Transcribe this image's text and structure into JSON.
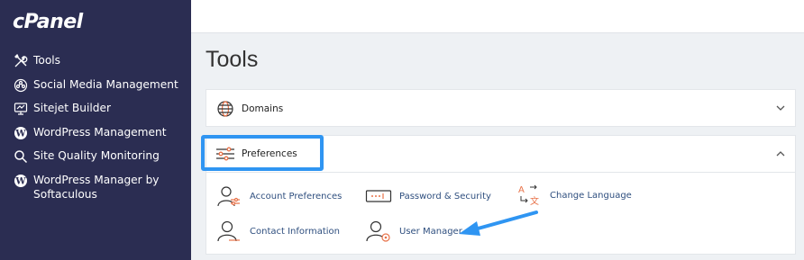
{
  "brand": {
    "logo": "cPanel"
  },
  "sidebar": {
    "items": [
      {
        "label": "Tools",
        "icon": "tools-icon"
      },
      {
        "label": "Social Media Management",
        "icon": "social-media-icon"
      },
      {
        "label": "Sitejet Builder",
        "icon": "sitejet-icon"
      },
      {
        "label": "WordPress Management",
        "icon": "wordpress-icon"
      },
      {
        "label": "Site Quality Monitoring",
        "icon": "magnifier-icon"
      },
      {
        "label": "WordPress Manager by Softaculous",
        "icon": "wordpress-icon"
      }
    ]
  },
  "main": {
    "title": "Tools",
    "sections": [
      {
        "label": "Domains",
        "icon": "globe-icon",
        "state": "collapsed"
      },
      {
        "label": "Preferences",
        "icon": "sliders-icon",
        "state": "expanded",
        "tools": [
          {
            "label": "Account Preferences",
            "icon": "account-preferences-icon"
          },
          {
            "label": "Password & Security",
            "icon": "password-icon"
          },
          {
            "label": "Change Language",
            "icon": "language-icon"
          },
          {
            "label": "Contact Information",
            "icon": "contact-icon"
          },
          {
            "label": "User Manager",
            "icon": "user-manager-icon"
          }
        ]
      }
    ]
  },
  "colors": {
    "sidebar_bg": "#2b2d52",
    "highlight": "#2f95f2",
    "accent_orange": "#e8734a",
    "link": "#2f4f7f"
  }
}
